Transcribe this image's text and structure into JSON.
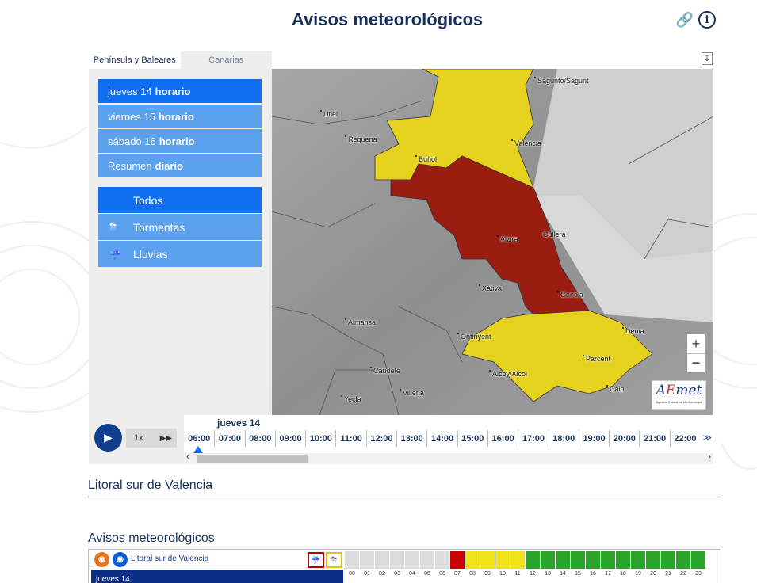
{
  "page": {
    "title": "Avisos meteorológicos",
    "link_icon": "link-icon",
    "info_icon": "info-icon"
  },
  "tabs": [
    "Península y Baleares",
    "Canarias"
  ],
  "days": [
    {
      "day": "jueves 14",
      "mode": "horario",
      "selected": true
    },
    {
      "day": "viernes 15",
      "mode": "horario",
      "selected": false
    },
    {
      "day": "sábado 16",
      "mode": "horario",
      "selected": false
    },
    {
      "day": "Resumen",
      "mode": "diario",
      "selected": false
    }
  ],
  "filters": [
    {
      "label": "Todos",
      "icon": "",
      "selected": true
    },
    {
      "label": "Tormentas",
      "icon": "storm-icon",
      "selected": false
    },
    {
      "label": "Lluvias",
      "icon": "rain-icon",
      "selected": false
    }
  ],
  "map": {
    "towns": [
      "Sagunto/Sagunt",
      "Utiel",
      "Requena",
      "València",
      "Buñol",
      "Alzira",
      "Cullera",
      "Xàtiva",
      "Gandia",
      "Almansa",
      "Ontinyent",
      "Dénia",
      "Parcent",
      "Alcoy/Alcoi",
      "Caudete",
      "Villena",
      "Calp",
      "Yecla"
    ],
    "colors": {
      "yellow": "#e6d21e",
      "red": "#9b1c10",
      "land": "#9d9d9d"
    },
    "zoom_in": "+",
    "zoom_out": "−",
    "logo_text": "AEmet",
    "logo_sub": "Agencia Estatal de Meteorología"
  },
  "player": {
    "speed": "1x",
    "day_label": "jueves 14",
    "hours": [
      "06:00",
      "07:00",
      "08:00",
      "09:00",
      "10:00",
      "11:00",
      "12:00",
      "13:00",
      "14:00",
      "15:00",
      "16:00",
      "17:00",
      "18:00",
      "19:00",
      "20:00",
      "21:00",
      "22:00"
    ]
  },
  "zone": {
    "title": "Litoral sur de Valencia"
  },
  "warnings": {
    "title": "Avisos meteorológicos",
    "zone_name": "Litoral sur de Valencia",
    "day": "jueves 14",
    "hour_labels": [
      "00",
      "01",
      "02",
      "03",
      "04",
      "05",
      "06",
      "07",
      "08",
      "09",
      "10",
      "11",
      "12",
      "13",
      "14",
      "15",
      "16",
      "17",
      "18",
      "19",
      "20",
      "21",
      "22",
      "23"
    ],
    "hour_levels": [
      "none",
      "none",
      "none",
      "none",
      "none",
      "none",
      "none",
      "red",
      "yellow",
      "yellow",
      "yellow",
      "yellow",
      "green",
      "green",
      "green",
      "green",
      "green",
      "green",
      "green",
      "green",
      "green",
      "green",
      "green",
      "green"
    ],
    "level_colors": {
      "none": "#dcdcdc",
      "red": "#cc0000",
      "yellow": "#f0e21a",
      "green": "#2aa32a"
    }
  }
}
